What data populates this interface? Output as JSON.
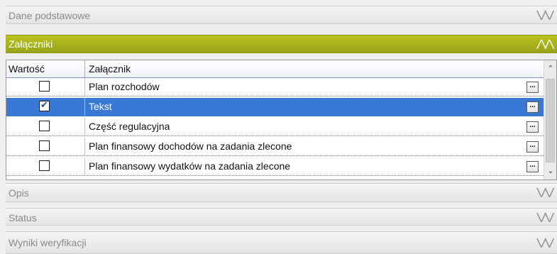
{
  "sections": {
    "dane_podstawowe": "Dane podstawowe",
    "zalaczniki": "Załączniki",
    "opis": "Opis",
    "status": "Status",
    "wyniki_weryfikacji": "Wyniki weryfikacji"
  },
  "grid": {
    "columns": [
      "Wartość",
      "Załącznik"
    ],
    "rows": [
      {
        "checked": false,
        "name": "Plan rozchodów",
        "selected": false
      },
      {
        "checked": true,
        "name": "Tekst",
        "selected": true
      },
      {
        "checked": false,
        "name": "Część regulacyjna",
        "selected": false
      },
      {
        "checked": false,
        "name": "Plan finansowy dochodów na zadania zlecone",
        "selected": false
      },
      {
        "checked": false,
        "name": "Plan finansowy wydatków na zadania zlecone",
        "selected": false
      }
    ],
    "ellipsis_label": "..."
  },
  "icons": {
    "collapse": "chevron-double-up-icon",
    "expand": "chevron-double-down-icon",
    "checkmark": "✔"
  },
  "colors": {
    "accent_header": "#a8b21a",
    "selection": "#3a78d6"
  }
}
